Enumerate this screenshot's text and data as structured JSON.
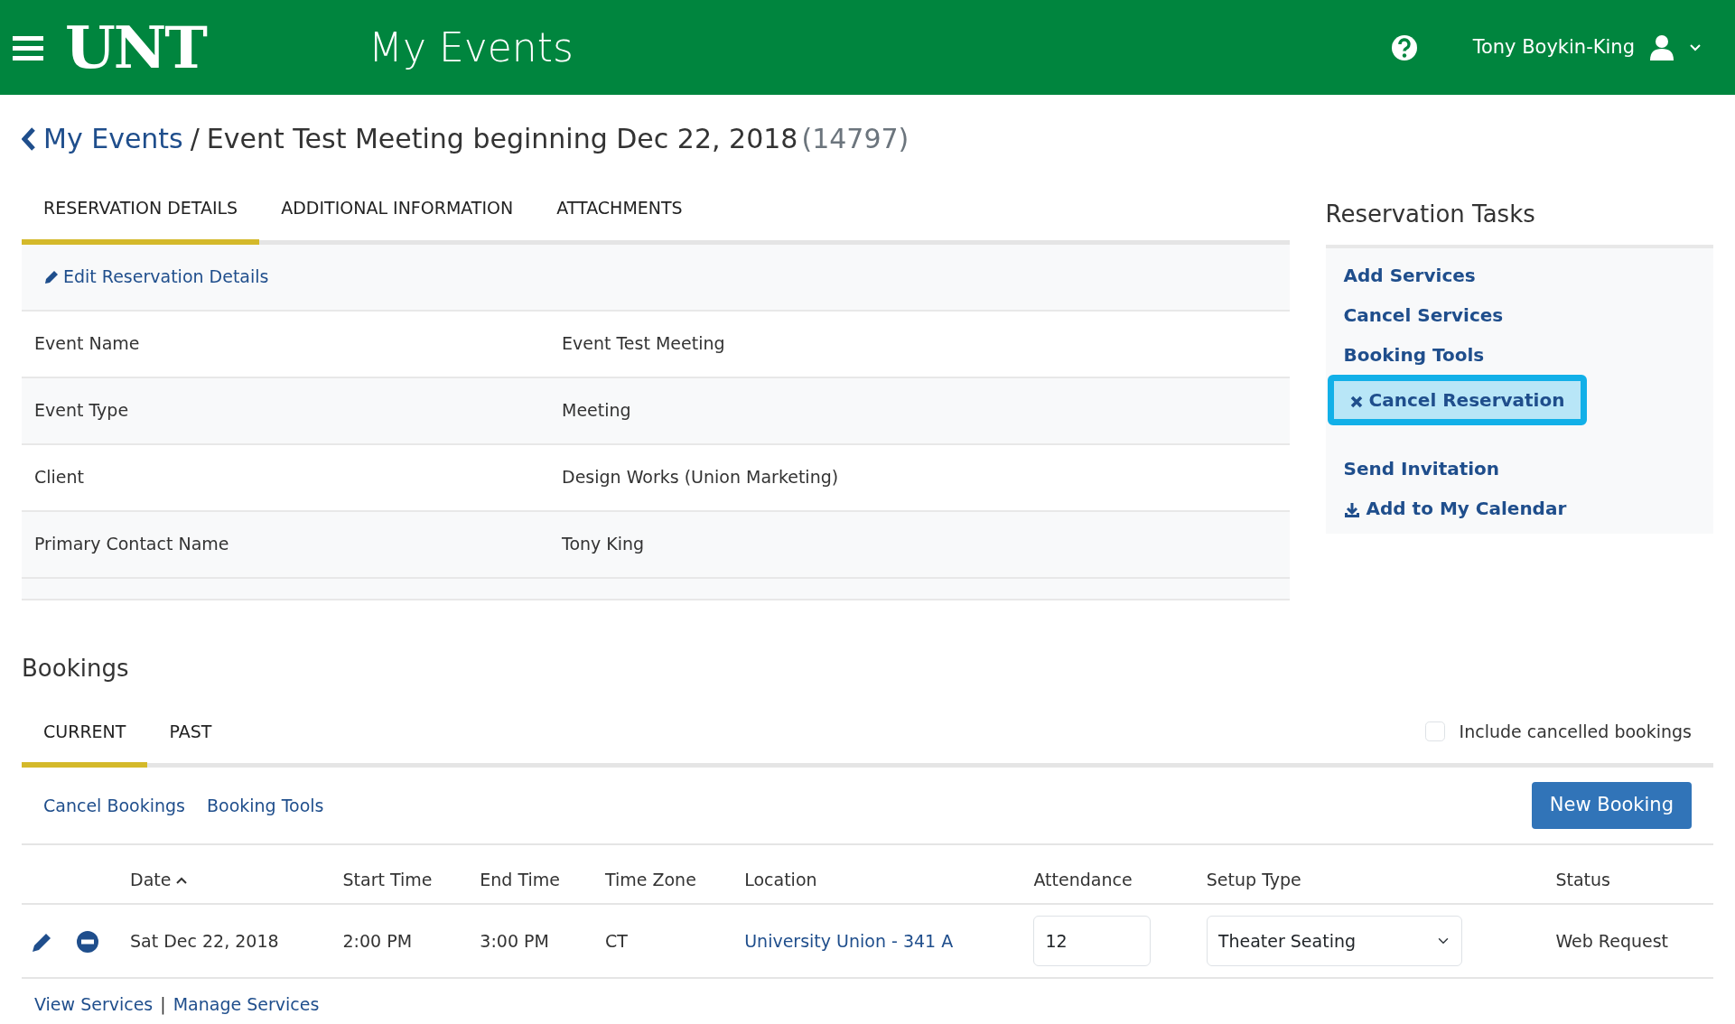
{
  "header": {
    "logo": "UNT",
    "title": "My Events",
    "user": "Tony Boykin-King"
  },
  "breadcrumb": {
    "parent": "My Events",
    "separator": "/",
    "current": "Event Test Meeting beginning Dec 22, 2018",
    "id": "(14797)"
  },
  "tabs": [
    {
      "label": "RESERVATION DETAILS",
      "selected": true
    },
    {
      "label": "ADDITIONAL INFORMATION",
      "selected": false
    },
    {
      "label": "ATTACHMENTS",
      "selected": false
    }
  ],
  "edit_link": "Edit Reservation Details",
  "details": [
    {
      "label": "Event Name",
      "value": "Event Test Meeting"
    },
    {
      "label": "Event Type",
      "value": "Meeting"
    },
    {
      "label": "Client",
      "value": "Design Works (Union Marketing)"
    },
    {
      "label": "Primary Contact Name",
      "value": "Tony King"
    }
  ],
  "tasks": {
    "title": "Reservation Tasks",
    "items": [
      {
        "label": "Add Services",
        "kind": "plain",
        "highlighted": false
      },
      {
        "label": "Cancel Services",
        "kind": "plain",
        "highlighted": false
      },
      {
        "label": "Booking Tools",
        "kind": "plain",
        "highlighted": false
      },
      {
        "label": "Cancel Reservation",
        "kind": "cancel",
        "highlighted": true
      },
      {
        "label": "Send Invitation",
        "kind": "plain",
        "highlighted": false
      },
      {
        "label": "Add to My Calendar",
        "kind": "download",
        "highlighted": false
      }
    ]
  },
  "bookings": {
    "title": "Bookings",
    "tabs": [
      {
        "label": "CURRENT",
        "selected": true
      },
      {
        "label": "PAST",
        "selected": false
      }
    ],
    "include_cancelled": {
      "label": "Include cancelled bookings",
      "checked": false
    },
    "actions": [
      "Cancel Bookings",
      "Booking Tools"
    ],
    "new_button": "New Booking",
    "columns": [
      {
        "label": "Date",
        "sorted": true
      },
      {
        "label": "Start Time",
        "sorted": false
      },
      {
        "label": "End Time",
        "sorted": false
      },
      {
        "label": "Time Zone",
        "sorted": false
      },
      {
        "label": "Location",
        "sorted": false
      },
      {
        "label": "Attendance",
        "sorted": false
      },
      {
        "label": "Setup Type",
        "sorted": false
      },
      {
        "label": "Status",
        "sorted": false
      }
    ],
    "rows": [
      {
        "date": "Sat Dec 22, 2018",
        "start": "2:00 PM",
        "end": "3:00 PM",
        "zone": "CT",
        "location": "University Union - 341 A",
        "attendance": "12",
        "setup": "Theater Seating",
        "status": "Web Request"
      }
    ],
    "footer_links": [
      "View Services",
      "Manage Services"
    ],
    "footer_separator": "|"
  }
}
